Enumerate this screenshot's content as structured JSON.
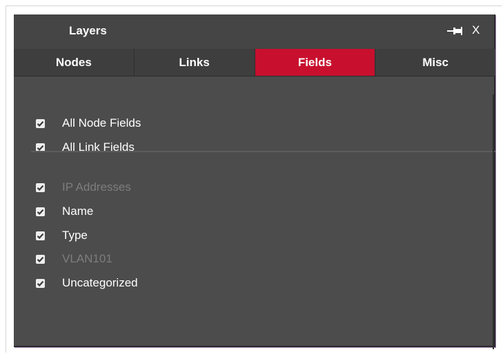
{
  "panel": {
    "title": "Layers",
    "close_label": "X",
    "pin_icon": "pin-icon"
  },
  "tabs": [
    {
      "label": "Nodes",
      "active": false
    },
    {
      "label": "Links",
      "active": false
    },
    {
      "label": "Fields",
      "active": true
    },
    {
      "label": "Misc",
      "active": false
    }
  ],
  "fields": {
    "summary": [
      {
        "label": "All Node Fields",
        "checked": true,
        "enabled": true
      },
      {
        "label": "All Link Fields",
        "checked": true,
        "enabled": true
      }
    ],
    "items": [
      {
        "label": "IP Addresses",
        "checked": true,
        "enabled": false
      },
      {
        "label": "Name",
        "checked": true,
        "enabled": true
      },
      {
        "label": "Type",
        "checked": true,
        "enabled": true
      },
      {
        "label": "VLAN101",
        "checked": true,
        "enabled": false
      },
      {
        "label": "Uncategorized",
        "checked": true,
        "enabled": true
      }
    ]
  },
  "colors": {
    "panel_bg": "#4c4c4c",
    "active_tab": "#c8102e",
    "text": "#ffffff",
    "disabled_text": "#7d7d7d"
  }
}
